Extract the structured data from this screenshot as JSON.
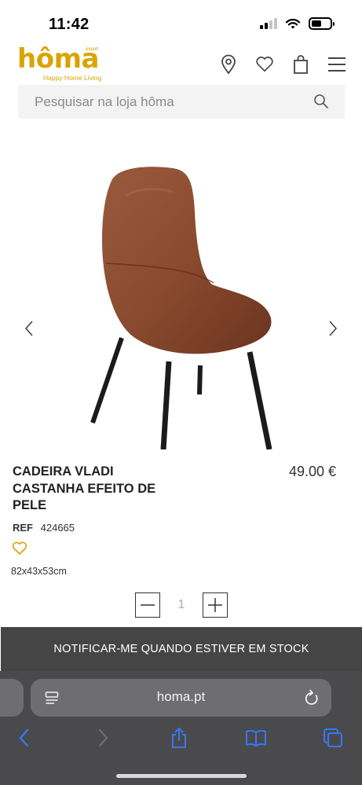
{
  "status_bar": {
    "time": "11:42"
  },
  "header": {
    "logo": {
      "word": "hôma",
      "tagline": "Happy Home Living",
      "badge": "export"
    }
  },
  "search": {
    "placeholder": "Pesquisar na loja hôma"
  },
  "product": {
    "name": "CADEIRA VLADI CASTANHA EFEITO DE PELE",
    "price": "49.00 €",
    "ref_label": "REF",
    "ref_value": "424665",
    "dimensions": "82x43x53cm",
    "quantity": "1",
    "notify_label": "NOTIFICAR-ME QUANDO ESTIVER EM STOCK"
  },
  "browser": {
    "url": "homa.pt"
  },
  "colors": {
    "brand": "#d9a400",
    "notify_bg": "#454545",
    "browser_accent": "#3478f6"
  }
}
